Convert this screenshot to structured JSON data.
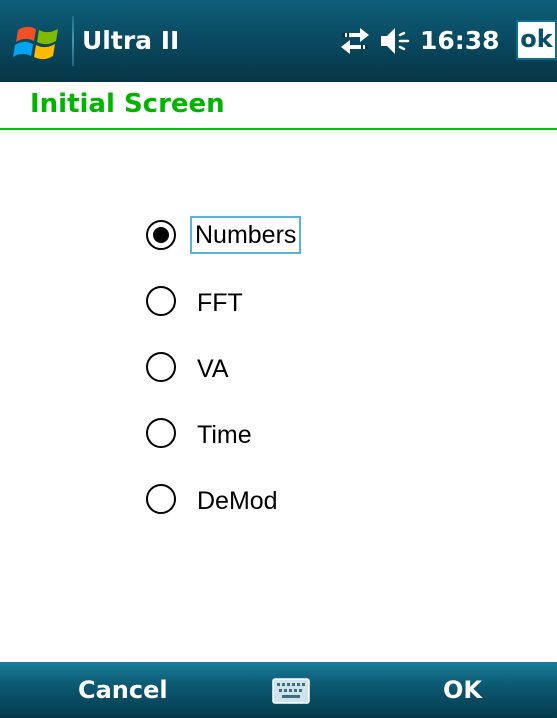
{
  "status_bar": {
    "app_title": "Ultra II",
    "time": "16:38",
    "ok_label": "ok",
    "start_icon": "windows-flag-icon",
    "connectivity_icon": "connectivity-arrows-icon",
    "volume_icon": "speaker-volume-icon"
  },
  "header": {
    "title": "Initial Screen"
  },
  "options": {
    "items": [
      {
        "label": "Numbers",
        "selected": true
      },
      {
        "label": "FFT",
        "selected": false
      },
      {
        "label": "VA",
        "selected": false
      },
      {
        "label": "Time",
        "selected": false
      },
      {
        "label": "DeMod",
        "selected": false
      }
    ]
  },
  "softkeys": {
    "left": "Cancel",
    "right": "OK",
    "keyboard_icon": "keyboard-icon"
  },
  "colors": {
    "title_bar": "#0a4b63",
    "header_text": "#00b400",
    "header_rule": "#00c400",
    "focus_border": "#5ab4d6"
  }
}
